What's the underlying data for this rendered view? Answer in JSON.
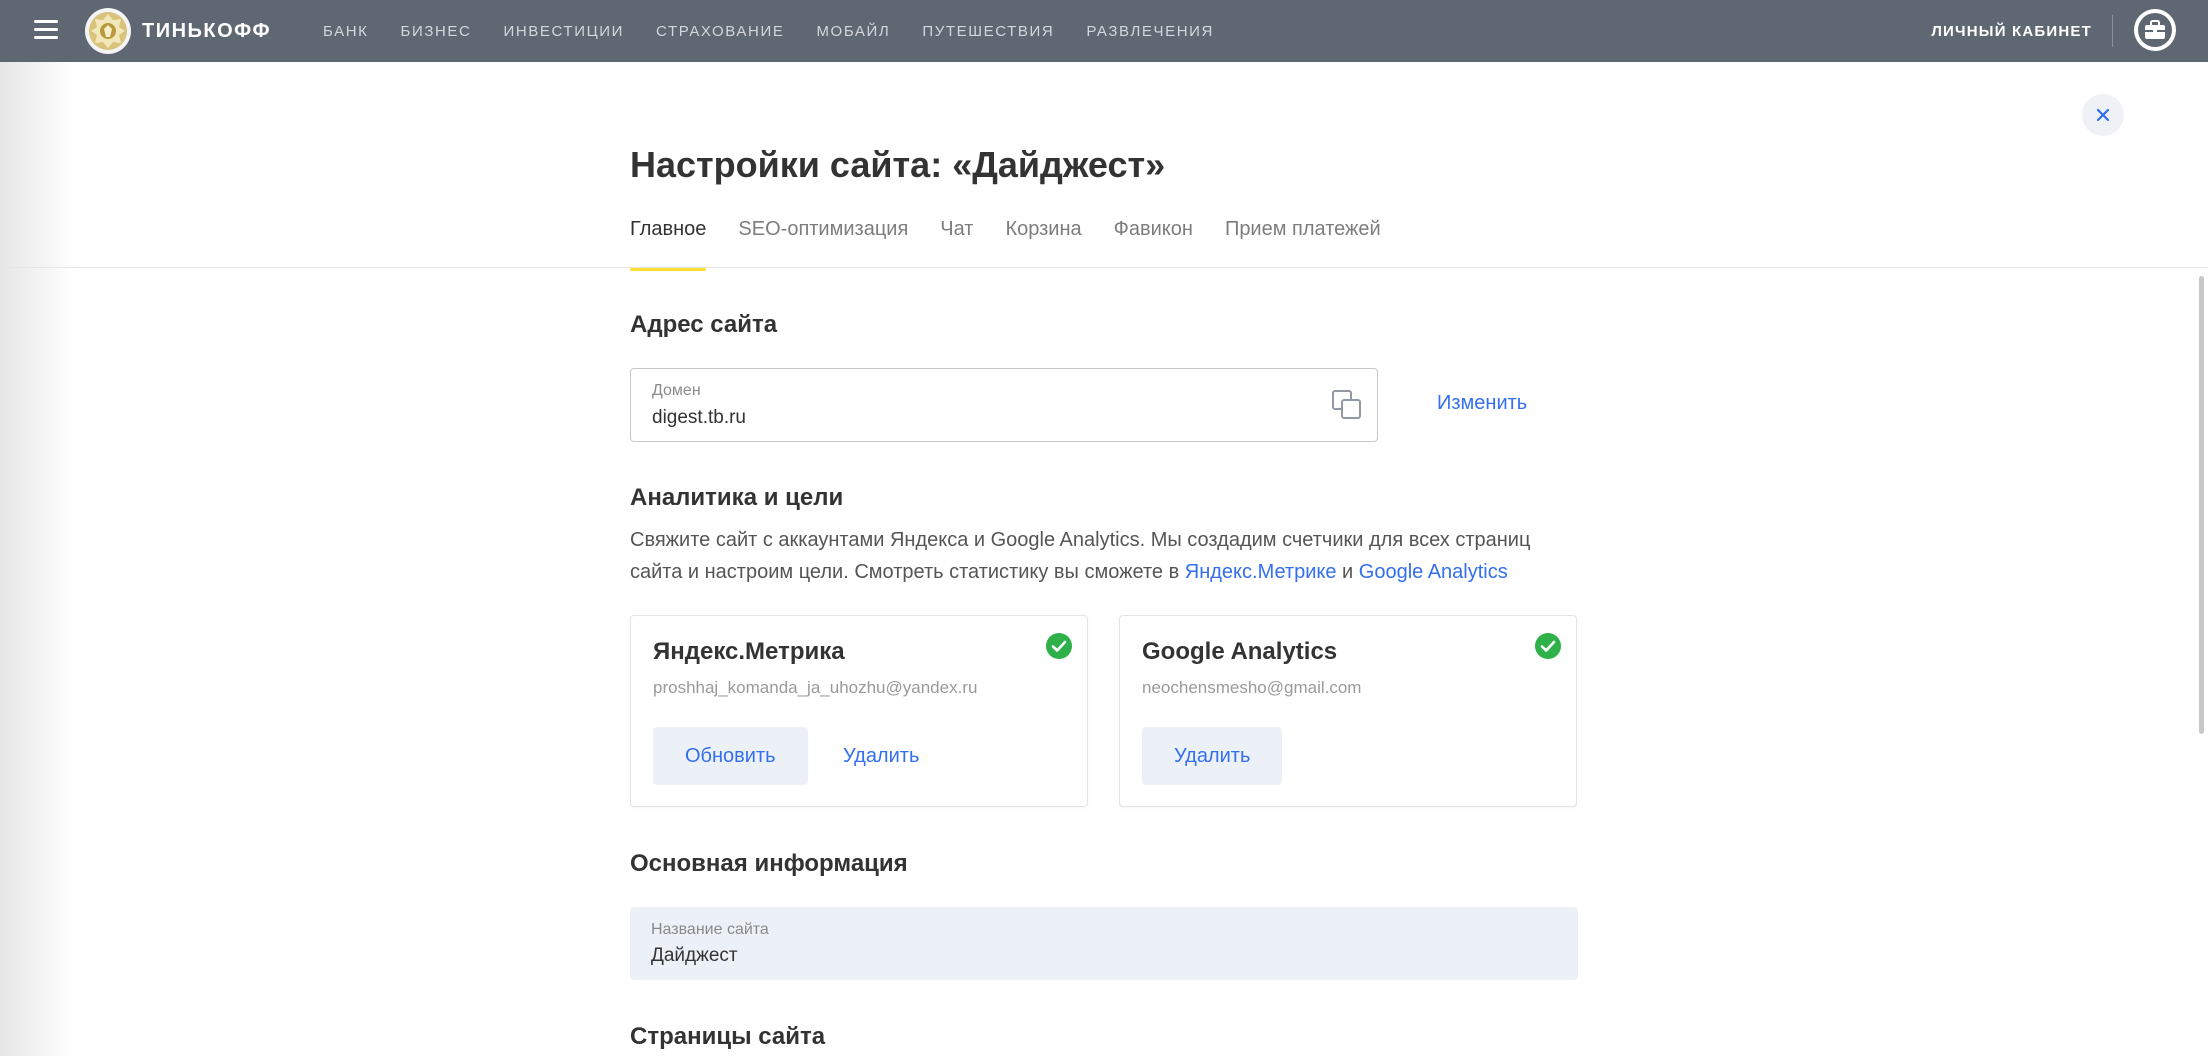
{
  "topbar": {
    "brand": "ТИНЬКОФФ",
    "nav": [
      "БАНК",
      "БИЗНЕС",
      "ИНВЕСТИЦИИ",
      "СТРАХОВАНИЕ",
      "МОБАЙЛ",
      "ПУТЕШЕСТВИЯ",
      "РАЗВЛЕЧЕНИЯ"
    ],
    "account_link": "ЛИЧНЫЙ КАБИНЕТ",
    "colors": {
      "background": "#5f6772",
      "nav_text": "#d3d7dc"
    }
  },
  "page": {
    "title": "Настройки сайта: «Дайджест»",
    "tabs": [
      {
        "label": "Главное",
        "active": true
      },
      {
        "label": "SEO-оптимизация",
        "active": false
      },
      {
        "label": "Чат",
        "active": false
      },
      {
        "label": "Корзина",
        "active": false
      },
      {
        "label": "Фавикон",
        "active": false
      },
      {
        "label": "Прием платежей",
        "active": false
      }
    ]
  },
  "address": {
    "heading": "Адрес сайта",
    "domain_label": "Домен",
    "domain_value": "digest.tb.ru",
    "change_link": "Изменить"
  },
  "analytics": {
    "heading": "Аналитика и цели",
    "desc_prefix": "Свяжите сайт с аккаунтами Яндекса и Google Analytics. Мы создадим счетчики для  всех страниц сайта и настроим цели. Смотреть статистику вы сможете в ",
    "link_yandex": "Яндекс.Метрике",
    "desc_and": " и ",
    "link_google": "Google Analytics",
    "cards": [
      {
        "title": "Яндекс.Метрика",
        "email": "proshhaj_komanda_ja_uhozhu@yandex.ru",
        "update_button": "Обновить",
        "delete_button": "Удалить",
        "connected": true
      },
      {
        "title": "Google Analytics",
        "email": "neochensmesho@gmail.com",
        "delete_button": "Удалить",
        "connected": true
      }
    ]
  },
  "basic_info": {
    "heading": "Основная информация",
    "name_label": "Название сайта",
    "name_value": "Дайджест"
  },
  "pages": {
    "heading": "Страницы сайта"
  },
  "icons": {
    "menu": "hamburger-menu-icon",
    "logo": "tinkoff-crest-logo",
    "account": "briefcase-icon",
    "close": "close-icon",
    "copy": "copy-icon",
    "check": "check-circle-icon"
  },
  "colors": {
    "accent": "#336fee",
    "tab_underline": "#ffdd2d",
    "success": "#2fb14a",
    "filled_field": "#ecf1f8"
  }
}
